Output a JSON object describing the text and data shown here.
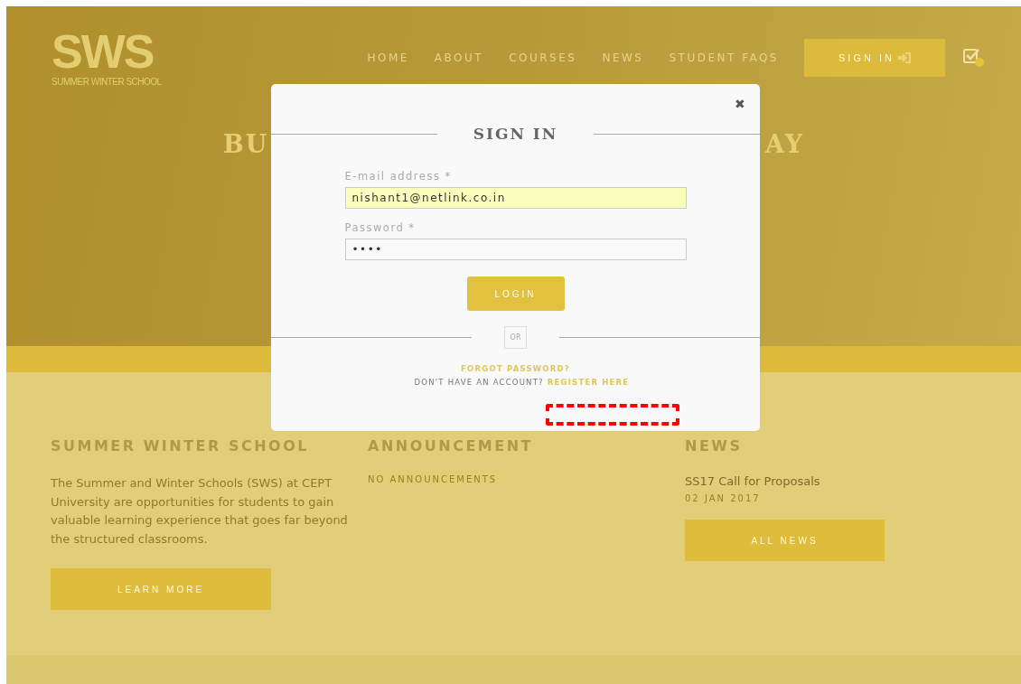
{
  "logo": {
    "mark": "SWS",
    "subtitle": "SUMMER WINTER SCHOOL"
  },
  "nav": [
    {
      "label": "HOME"
    },
    {
      "label": "ABOUT"
    },
    {
      "label": "COURSES"
    },
    {
      "label": "NEWS"
    },
    {
      "label": "STUDENT FAQS"
    }
  ],
  "sign_in_button": {
    "label": "SIGN IN"
  },
  "hero": {
    "title_left": "BU",
    "title_right": "AY"
  },
  "sections": [
    {
      "heading": "SUMMER WINTER SCHOOL",
      "body": "The Summer and Winter Schools (SWS) at CEPT University are opportunities for students to gain valuable learning experience that goes far beyond the structured classrooms.",
      "button": "LEARN MORE"
    },
    {
      "heading": "ANNOUNCEMENT",
      "note": "NO ANNOUNCEMENTS"
    },
    {
      "heading": "NEWS",
      "item": "SS17 Call for Proposals",
      "date": "02 JAN 2017",
      "button": "ALL NEWS"
    }
  ],
  "modal": {
    "title": "SIGN IN",
    "close": "✖",
    "fields": [
      {
        "label": "E-mail address *",
        "value": "nishant1@netlink.co.in",
        "autofilled": true,
        "kind": "text"
      },
      {
        "label": "Password *",
        "value": "••••",
        "autofilled": false,
        "kind": "password"
      }
    ],
    "login_button": "LOGIN",
    "divider": "OR",
    "forgot_link": "FORGOT PASSWORD?",
    "register_prompt": "DON'T HAVE AN ACCOUNT?",
    "register_link": "REGISTER HERE"
  }
}
